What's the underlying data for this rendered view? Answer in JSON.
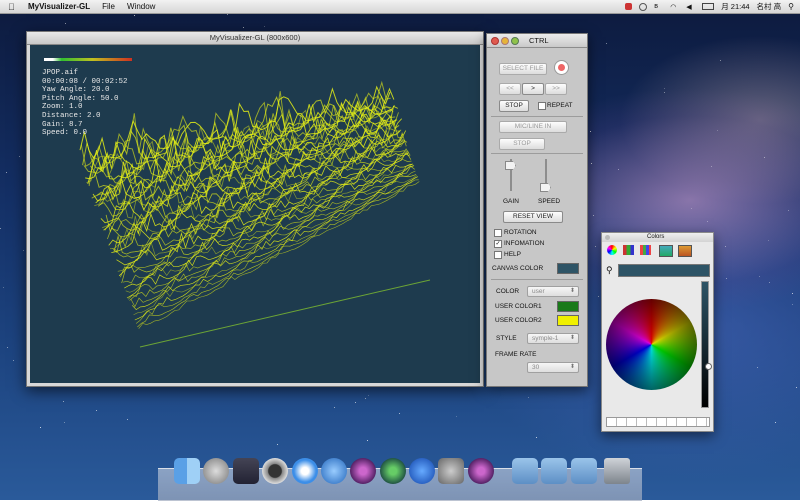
{
  "menubar": {
    "app_name": "MyVisualizer-GL",
    "menus": [
      "File",
      "Window"
    ],
    "clock": "月 21:44",
    "user": "名村 高"
  },
  "main_window": {
    "title": "MyVisualizer-GL (800x600)",
    "info": {
      "file": "JPOP.aif",
      "time": "00:00:08 / 00:02:52",
      "yaw": "Yaw Angle: 20.0",
      "pitch": "Pitch Angle: 50.0",
      "zoom": "Zoom:  1.0",
      "distance": "Distance:  2.0",
      "gain": "Gain:  8.7",
      "speed": "Speed:  0.0"
    },
    "canvas_color": "#1e3b4e",
    "viz_color": "#e6f016"
  },
  "ctrl": {
    "title": "CTRL",
    "select_file": "SELECT FILE",
    "prev": "<<",
    "play": ">",
    "next": ">>",
    "stop": "STOP",
    "repeat": "REPEAT",
    "mic_line_in": "MIC/LINE IN",
    "mic_stop": "STOP",
    "gain_label": "GAIN",
    "speed_label": "SPEED",
    "reset_view": "RESET VIEW",
    "rotation": "ROTATION",
    "information": "INFOMATION",
    "help": "HELP",
    "canvas_color_label": "CANVAS COLOR",
    "color_label": "COLOR",
    "color_value": "user",
    "user_color1_label": "USER COLOR1",
    "user_color2_label": "USER COLOR2",
    "user_color1": "#1a7a1a",
    "user_color2": "#f0f000",
    "style_label": "STYLE",
    "style_value": "symple-1",
    "frame_rate_label": "FRAME RATE",
    "frame_rate_value": "30",
    "information_checked": true,
    "rotation_checked": false,
    "help_checked": false,
    "repeat_checked": false
  },
  "colors_panel": {
    "title": "Colors",
    "current_color": "#2e5466"
  }
}
